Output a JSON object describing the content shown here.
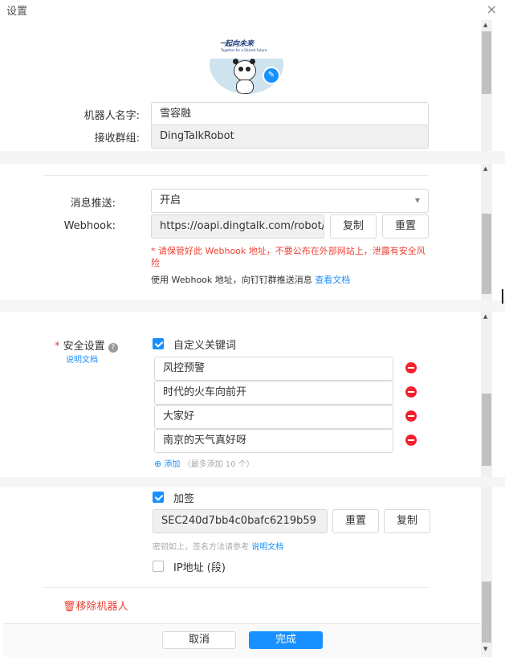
{
  "dialog": {
    "title": "设置",
    "close_glyph": "×"
  },
  "avatar": {
    "banner_text": "一起向未来",
    "sub_text": "Together for a Shared Future"
  },
  "robot": {
    "name_label": "机器人名字:",
    "name_value": "雪容融",
    "group_label": "接收群组:",
    "group_value": "DingTalkRobot"
  },
  "push": {
    "label": "消息推送:",
    "value": "开启",
    "webhook_label": "Webhook:",
    "webhook_value": "https://oapi.dingtalk.com/robot/send?access_token=",
    "copy_button": "复制",
    "reset_button": "重置",
    "warning": "* 请保管好此 Webhook 地址，不要公布在外部网站上，泄露有安全风险",
    "usage_text": "使用 Webhook 地址，向钉钉群推送消息",
    "usage_link": "查看文档"
  },
  "security": {
    "required_mark": "*",
    "label": "安全设置",
    "help_glyph": "?",
    "doc_link": "说明文档",
    "keywords_label": "自定义关键词",
    "keywords": [
      "风控预警",
      "时代的火车向前开",
      "大家好",
      "南京的天气真好呀"
    ],
    "add_link": "添加",
    "add_hint": "（最多添加 10 个）",
    "sign_label": "加签",
    "sign_value": "SEC240d7bb4c0bafc6219b59",
    "sign_reset": "重置",
    "sign_copy": "复制",
    "sign_hint": "密钥如上，签名方法请参考",
    "sign_hint_link": "说明文档",
    "ip_label": "IP地址 (段)"
  },
  "remove": {
    "label": "移除机器人"
  },
  "footer": {
    "cancel": "取消",
    "done": "完成"
  },
  "colors": {
    "primary": "#1890ff",
    "danger": "#f04134"
  }
}
